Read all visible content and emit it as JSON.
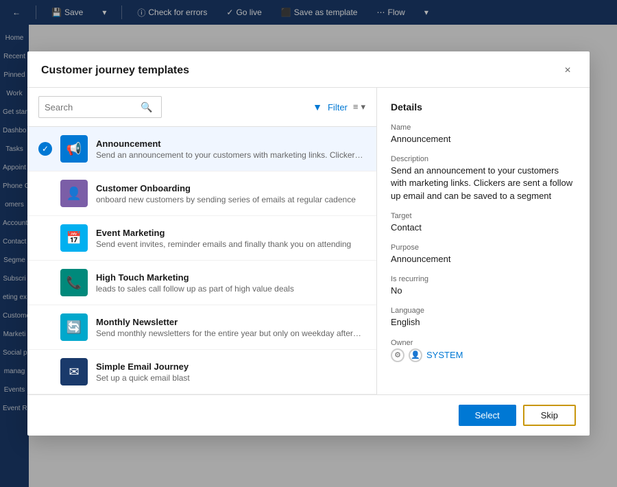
{
  "toolbar": {
    "back_label": "←",
    "save_label": "Save",
    "check_errors_label": "Check for errors",
    "go_live_label": "Go live",
    "save_template_label": "Save as template",
    "flow_label": "Flow"
  },
  "sidebar": {
    "items": [
      {
        "label": "Home"
      },
      {
        "label": "Recent"
      },
      {
        "label": "Pinned"
      },
      {
        "label": "Work"
      },
      {
        "label": "Get start"
      },
      {
        "label": "Dashbo"
      },
      {
        "label": "Tasks"
      },
      {
        "label": "Appoint"
      },
      {
        "label": "Phone C"
      },
      {
        "label": "omers"
      },
      {
        "label": "Account"
      },
      {
        "label": "Contact"
      },
      {
        "label": "Segme"
      },
      {
        "label": "Subscri"
      },
      {
        "label": "eting ex"
      },
      {
        "label": "Custome"
      },
      {
        "label": "Marketi"
      },
      {
        "label": "Social p"
      },
      {
        "label": "manag"
      },
      {
        "label": "Events"
      },
      {
        "label": "Event Re"
      }
    ]
  },
  "modal": {
    "title": "Customer journey templates",
    "close_label": "×",
    "search": {
      "placeholder": "Search",
      "value": ""
    },
    "filter_label": "Filter",
    "templates": [
      {
        "id": "announcement",
        "name": "Announcement",
        "description": "Send an announcement to your customers with marketing links. Clickers are sent a...",
        "icon": "megaphone",
        "icon_color": "blue",
        "selected": true
      },
      {
        "id": "customer-onboarding",
        "name": "Customer Onboarding",
        "description": "onboard new customers by sending series of emails at regular cadence",
        "icon": "person",
        "icon_color": "purple",
        "selected": false
      },
      {
        "id": "event-marketing",
        "name": "Event Marketing",
        "description": "Send event invites, reminder emails and finally thank you on attending",
        "icon": "calendar",
        "icon_color": "teal-blue",
        "selected": false
      },
      {
        "id": "high-touch-marketing",
        "name": "High Touch Marketing",
        "description": "leads to sales call follow up as part of high value deals",
        "icon": "phone",
        "icon_color": "green",
        "selected": false
      },
      {
        "id": "monthly-newsletter",
        "name": "Monthly Newsletter",
        "description": "Send monthly newsletters for the entire year but only on weekday afternoons",
        "icon": "refresh",
        "icon_color": "cyan",
        "selected": false
      },
      {
        "id": "simple-email",
        "name": "Simple Email Journey",
        "description": "Set up a quick email blast",
        "icon": "email",
        "icon_color": "dark-blue",
        "selected": false
      }
    ],
    "details": {
      "section_title": "Details",
      "name_label": "Name",
      "name_value": "Announcement",
      "description_label": "Description",
      "description_value": "Send an announcement to your customers with marketing links. Clickers are sent a follow up email and can be saved to a segment",
      "target_label": "Target",
      "target_value": "Contact",
      "purpose_label": "Purpose",
      "purpose_value": "Announcement",
      "recurring_label": "Is recurring",
      "recurring_value": "No",
      "language_label": "Language",
      "language_value": "English",
      "owner_label": "Owner",
      "owner_value": "SYSTEM"
    },
    "footer": {
      "select_label": "Select",
      "skip_label": "Skip"
    }
  }
}
